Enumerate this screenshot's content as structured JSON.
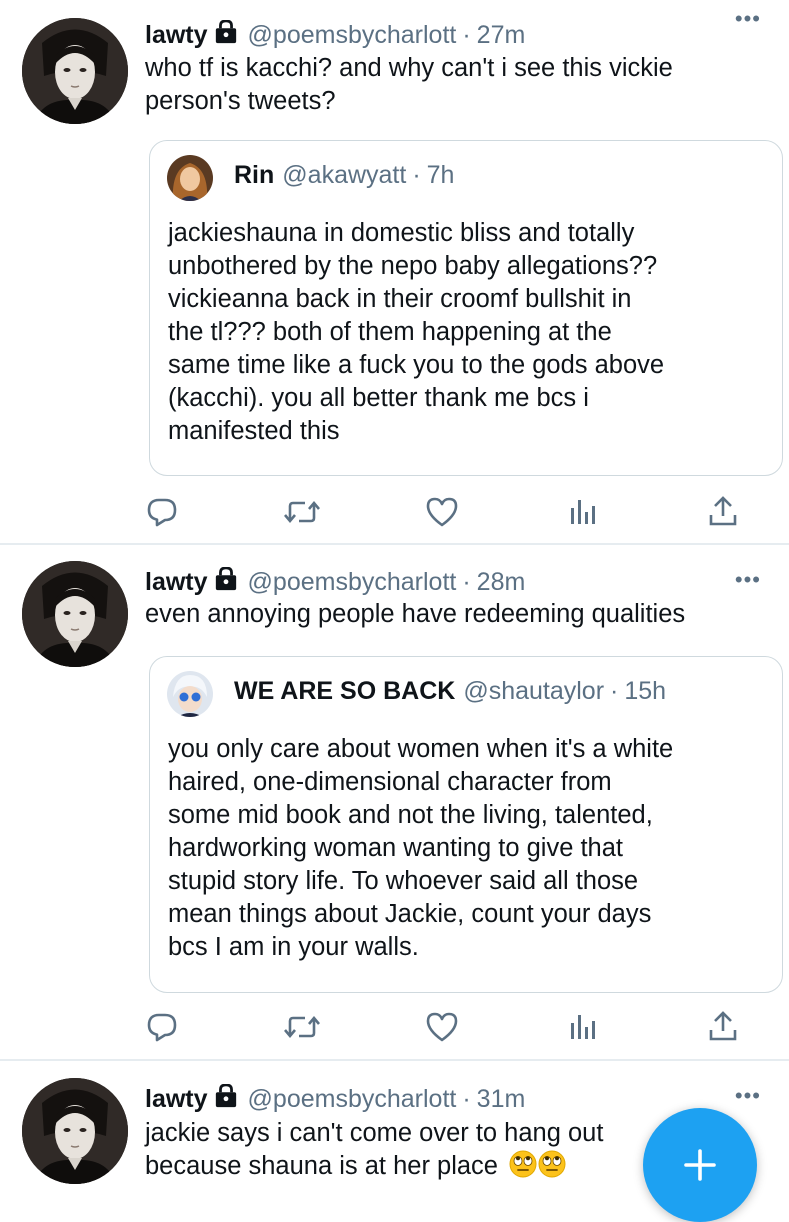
{
  "colors": {
    "accent": "#1da1f2",
    "muted": "#5b7083",
    "divider": "#e6ecf0"
  },
  "tweets": [
    {
      "name": "lawty",
      "handle": "@poemsbycharlott",
      "dot": "·",
      "time": "27m",
      "more": "•••",
      "text": [
        "who tf is kacchi? and why can't i see this vickie",
        "person's tweets?"
      ],
      "quote": {
        "name": "Rin",
        "handle": "@akawyatt",
        "dot": "·",
        "time": "7h",
        "text": [
          "jackieshauna in domestic bliss and totally",
          "unbothered by the nepo baby allegations??",
          "vickieanna back in their croomf bullshit in",
          "the tl??? both of them happening at the",
          "same time like a fuck you to the gods above",
          "(kacchi). you all better thank me bcs i",
          "manifested this"
        ]
      }
    },
    {
      "name": "lawty",
      "handle": "@poemsbycharlott",
      "dot": "·",
      "time": "28m",
      "more": "•••",
      "text": [
        "even annoying people have redeeming qualities"
      ],
      "quote": {
        "name": "WE ARE SO BACK",
        "handle": "@shautaylor",
        "dot": "·",
        "time": "15h",
        "text": [
          "you only care about women when it's a white",
          "haired, one-dimensional character from",
          "some mid book and not the living, talented,",
          "hardworking woman wanting to give that",
          "stupid story life. To whoever said all those",
          "mean things about Jackie, count your days",
          "bcs I am in your walls."
        ]
      }
    },
    {
      "name": "lawty",
      "handle": "@poemsbycharlott",
      "dot": "·",
      "time": "31m",
      "more": "•••",
      "text": [
        "jackie says i can't come over to hang out",
        "because shauna is at her place"
      ]
    }
  ],
  "icons": {
    "reply": "reply-icon",
    "retweet": "retweet-icon",
    "like": "heart-icon",
    "analytics": "analytics-icon",
    "share": "share-icon",
    "lock": "lock-icon",
    "compose": "plus-icon",
    "emoji": "face-with-rolling-eyes-icon"
  }
}
